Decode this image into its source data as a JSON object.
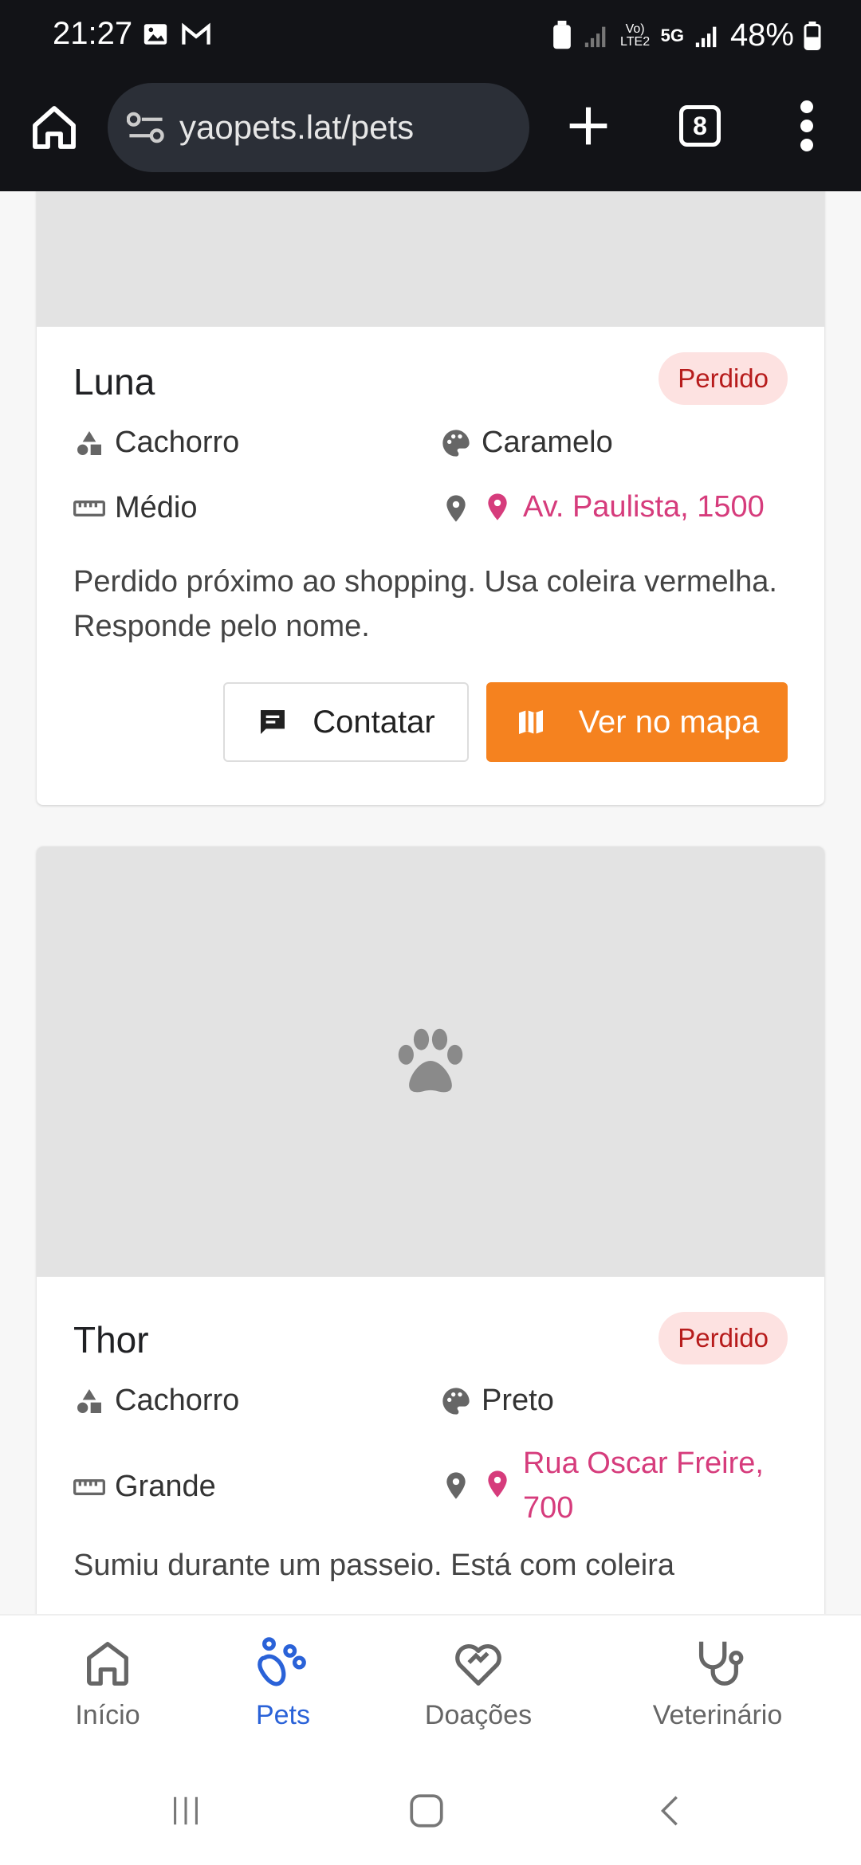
{
  "status_bar": {
    "time": "21:27",
    "battery": "48%",
    "network_label": "5G",
    "volte_label": "Vo) LTE2"
  },
  "browser": {
    "url": "yaopets.lat/pets",
    "tab_count": "8"
  },
  "pets": [
    {
      "name": "Luna",
      "status": "Perdido",
      "species": "Cachorro",
      "color": "Caramelo",
      "size": "Médio",
      "location": "Av. Paulista, 1500",
      "description": "Perdido próximo ao shopping. Usa coleira vermelha. Responde pelo nome.",
      "contact_label": "Contatar",
      "map_label": "Ver no mapa"
    },
    {
      "name": "Thor",
      "status": "Perdido",
      "species": "Cachorro",
      "color": "Preto",
      "size": "Grande",
      "location": "Rua Oscar Freire, 700",
      "description": "Sumiu durante um passeio. Está com coleira"
    }
  ],
  "bottom_nav": [
    {
      "label": "Início",
      "icon": "home-icon"
    },
    {
      "label": "Pets",
      "icon": "paw-icon",
      "active": true
    },
    {
      "label": "Doações",
      "icon": "heart-hands-icon"
    },
    {
      "label": "Veterinário",
      "icon": "stethoscope-icon"
    }
  ],
  "colors": {
    "accent": "#f5821f",
    "badge_bg": "#fde2e1",
    "badge_text": "#b71c1c",
    "location": "#d63c7c",
    "nav_active": "#2a62d8"
  }
}
